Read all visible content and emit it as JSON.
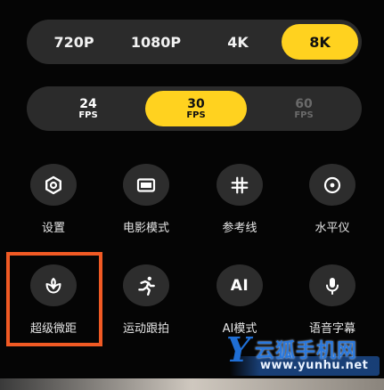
{
  "resolution": {
    "options": [
      "720P",
      "1080P",
      "4K",
      "8K"
    ],
    "selected": "8K"
  },
  "fps": {
    "options": [
      {
        "num": "24",
        "unit": "FPS",
        "state": "normal"
      },
      {
        "num": "30",
        "unit": "FPS",
        "state": "selected"
      },
      {
        "num": "60",
        "unit": "FPS",
        "state": "disabled"
      }
    ]
  },
  "tools": {
    "settings": {
      "label": "设置",
      "icon": "gear-icon"
    },
    "cinema_mode": {
      "label": "电影模式",
      "icon": "widescreen-icon"
    },
    "grid_lines": {
      "label": "参考线",
      "icon": "grid-icon"
    },
    "level": {
      "label": "水平仪",
      "icon": "level-icon"
    },
    "super_macro": {
      "label": "超级微距",
      "icon": "flower-icon"
    },
    "motion_tracking": {
      "label": "运动跟拍",
      "icon": "running-man-icon"
    },
    "ai_mode": {
      "label": "AI模式",
      "icon_text": "AI"
    },
    "voice_subtitles": {
      "label": "语音字幕",
      "icon": "microphone-icon"
    }
  },
  "watermark": {
    "logo": "Y",
    "title": "云狐手机网",
    "url": "www.yunhu.net"
  },
  "colors": {
    "accent": "#ffd21f",
    "highlight": "#f15a24",
    "pill_bg": "#2b2b2b",
    "icon_bg": "#2d2d2d"
  }
}
